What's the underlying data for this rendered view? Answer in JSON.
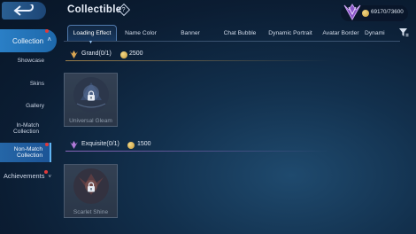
{
  "header": {
    "title": "Collectible",
    "help_symbol": "?",
    "currency_value": "69170/73600"
  },
  "sidebar": {
    "header_label": "Collection",
    "items": [
      {
        "label": "Showcase"
      },
      {
        "label": "Skins"
      },
      {
        "label": "Gallery"
      },
      {
        "label": "In-Match Collection"
      },
      {
        "label": "Non-Match Collection",
        "active": true
      }
    ],
    "footer_label": "Achievements"
  },
  "tabs": [
    {
      "label": "Loading Effect",
      "active": true
    },
    {
      "label": "Name Color"
    },
    {
      "label": "Banner"
    },
    {
      "label": "Chat Bubble"
    },
    {
      "label": "Dynamic Portrait"
    },
    {
      "label": "Avatar Border"
    },
    {
      "label": "Dynami"
    }
  ],
  "sections": [
    {
      "title": "Grand(0/1)",
      "price": "2500",
      "items": [
        {
          "label": "Universal Gleam",
          "locked": true
        }
      ]
    },
    {
      "title": "Exquisite(0/1)",
      "price": "1500",
      "items": [
        {
          "label": "Scarlet Shine",
          "locked": true
        }
      ]
    }
  ],
  "colors": {
    "accent": "#2a7fc6",
    "grand": "#d9a552",
    "exquisite": "#b07ad8",
    "notification": "#e03a3a"
  }
}
